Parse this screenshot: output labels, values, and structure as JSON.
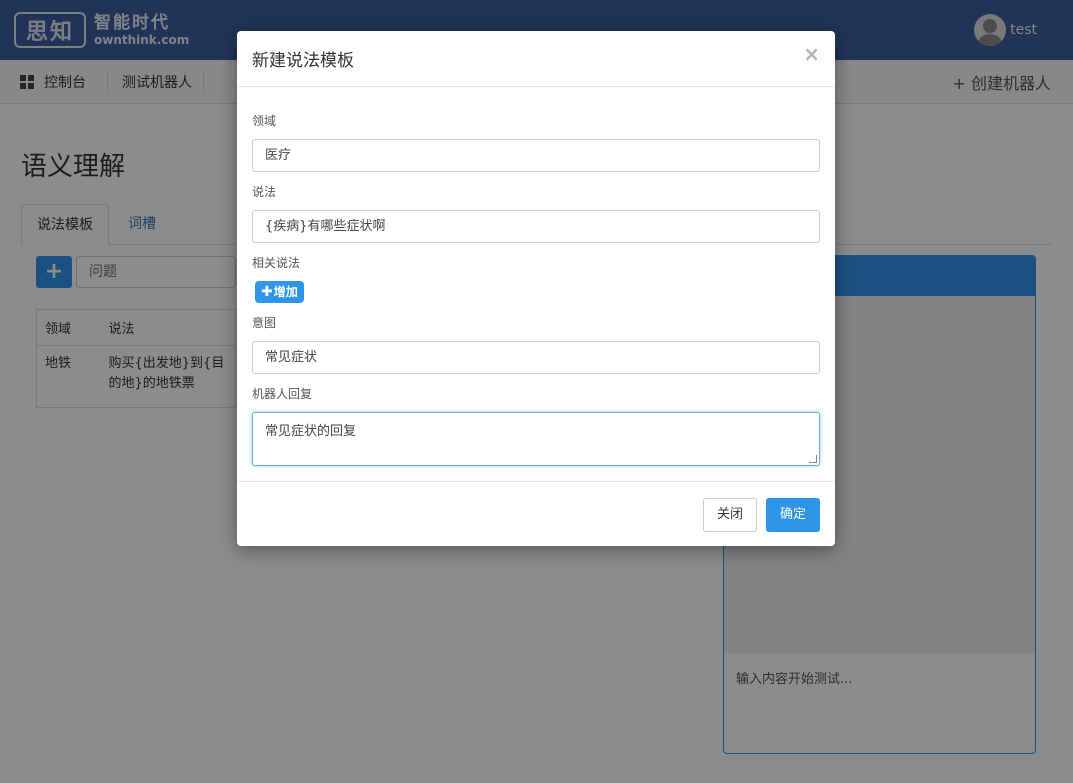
{
  "header": {
    "logo_mark": "思知",
    "logo_cn": "智能时代",
    "logo_en": "ownthink.com",
    "username": "test"
  },
  "nav": {
    "dashboard": "控制台",
    "bot": "测试机器人",
    "create": "+ 创建机器人"
  },
  "page": {
    "title": "语义理解",
    "tabs": [
      "说法模板",
      "词槽"
    ],
    "add_symbol": "+",
    "search_placeholder": "问题",
    "table": {
      "headers": [
        "领域",
        "说法"
      ],
      "rows": [
        {
          "domain": "地铁",
          "phrase": "购买{出发地}到{目的地}的地铁票"
        }
      ]
    },
    "test_hint": "输入内容开始测试..."
  },
  "modal": {
    "title": "新建说法模板",
    "close_symbol": "×",
    "domain_label": "领域",
    "domain_value": "医疗",
    "phrase_label": "说法",
    "phrase_value": "{疾病}有哪些症状啊",
    "related_label": "相关说法",
    "add_label": "增加",
    "intent_label": "意图",
    "intent_value": "常见症状",
    "reply_label": "机器人回复",
    "reply_value": "常见症状的回复",
    "btn_close": "关闭",
    "btn_ok": "确定"
  },
  "colors": {
    "header_bg": "#3c5d9f",
    "primary": "#2f95e9"
  }
}
